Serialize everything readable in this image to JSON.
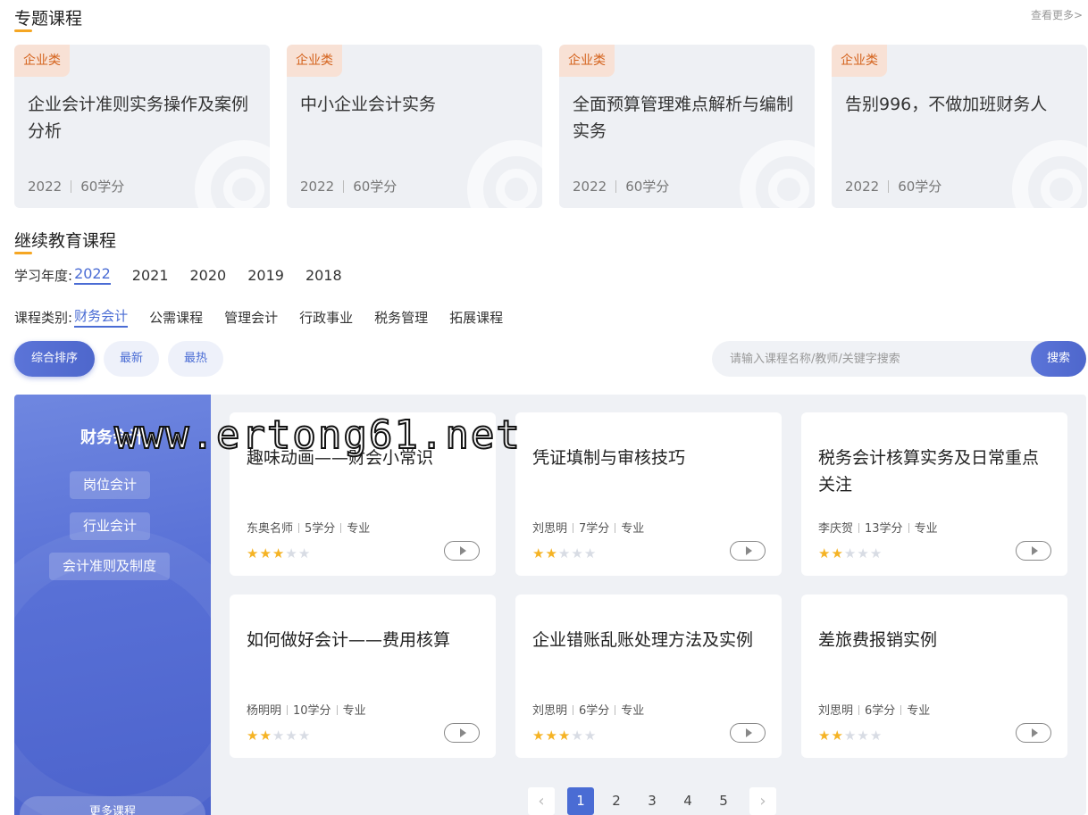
{
  "topic_section": {
    "title": "专题课程",
    "more": "查看更多>",
    "cards": [
      {
        "tag": "企业类",
        "title": "企业会计准则实务操作及案例分析",
        "year": "2022",
        "credits": "60学分"
      },
      {
        "tag": "企业类",
        "title": "中小企业会计实务",
        "year": "2022",
        "credits": "60学分"
      },
      {
        "tag": "企业类",
        "title": "全面预算管理难点解析与编制实务",
        "year": "2022",
        "credits": "60学分"
      },
      {
        "tag": "企业类",
        "title": "告别996，不做加班财务人",
        "year": "2022",
        "credits": "60学分"
      }
    ]
  },
  "edu_section": {
    "title": "继续教育课程",
    "year_filter": {
      "label": "学习年度:",
      "options": [
        "2022",
        "2021",
        "2020",
        "2019",
        "2018"
      ],
      "selected": "2022"
    },
    "category_filter": {
      "label": "课程类别:",
      "options": [
        "财务会计",
        "公需课程",
        "管理会计",
        "行政事业",
        "税务管理",
        "拓展课程"
      ],
      "selected": "财务会计"
    },
    "sort": {
      "options": [
        "综合排序",
        "最新",
        "最热"
      ],
      "selected": "综合排序"
    },
    "search": {
      "placeholder": "请输入课程名称/教师/关键字搜索",
      "value": "",
      "button": "搜索"
    }
  },
  "side_panel": {
    "title": "财务会计",
    "items": [
      "岗位会计",
      "行业会计",
      "会计准则及制度"
    ],
    "more": "更多课程"
  },
  "courses": [
    {
      "title": "趣味动画——财会小常识",
      "teacher": "东奥名师",
      "credits": "5学分",
      "type": "专业",
      "rating": 3
    },
    {
      "title": "凭证填制与审核技巧",
      "teacher": "刘思明",
      "credits": "7学分",
      "type": "专业",
      "rating": 2
    },
    {
      "title": "税务会计核算实务及日常重点关注",
      "teacher": "李庆贺",
      "credits": "13学分",
      "type": "专业",
      "rating": 2
    },
    {
      "title": "如何做好会计——费用核算",
      "teacher": "杨明明",
      "credits": "10学分",
      "type": "专业",
      "rating": 2
    },
    {
      "title": "企业错账乱账处理方法及实例",
      "teacher": "刘思明",
      "credits": "6学分",
      "type": "专业",
      "rating": 3
    },
    {
      "title": "差旅费报销实例",
      "teacher": "刘思明",
      "credits": "6学分",
      "type": "专业",
      "rating": 2
    }
  ],
  "pagination": {
    "prev": "‹",
    "pages": [
      "1",
      "2",
      "3",
      "4",
      "5"
    ],
    "current": "1",
    "next": "›"
  },
  "watermark": "www.ertong61.net",
  "colors": {
    "accent": "#4a6cd4",
    "tag_text": "#d4621c",
    "tag_bg": "#f8e1d5",
    "underline": "#f5a623",
    "star": "#f5b324"
  }
}
